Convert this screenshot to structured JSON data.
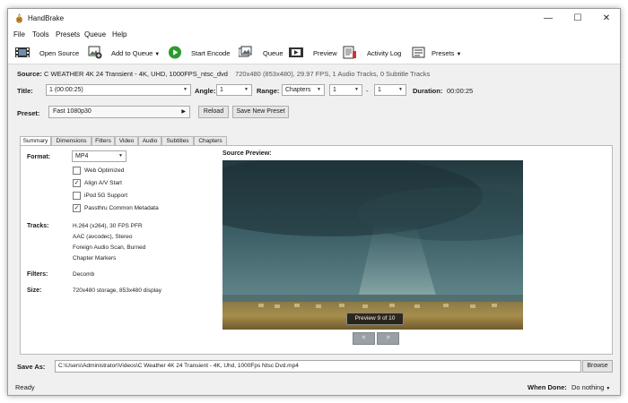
{
  "window": {
    "title": "HandBrake"
  },
  "menu": [
    "File",
    "Tools",
    "Presets",
    "Queue",
    "Help"
  ],
  "toolbar": {
    "open_source": "Open Source",
    "add_to_queue": "Add to Queue",
    "start_encode": "Start Encode",
    "queue": "Queue",
    "preview": "Preview",
    "activity_log": "Activity Log",
    "presets": "Presets"
  },
  "source": {
    "label": "Source:",
    "name": "C  WEATHER  4K 24  Transient - 4K, UHD, 1000FPS_ntsc_dvd",
    "details": "720x480 (853x480), 29.97 FPS, 1 Audio Tracks, 0 Subtitle Tracks"
  },
  "title_row": {
    "title_label": "Title:",
    "title_value": "1  (00:00:25)",
    "angle_label": "Angle:",
    "angle_value": "1",
    "range_label": "Range:",
    "range_type": "Chapters",
    "range_start": "1",
    "range_sep": "-",
    "range_end": "1",
    "duration_label": "Duration:",
    "duration_value": "00:00:25"
  },
  "preset_row": {
    "label": "Preset:",
    "value": "Fast 1080p30",
    "reload": "Reload",
    "save_new": "Save New Preset"
  },
  "tabs": [
    "Summary",
    "Dimensions",
    "Filters",
    "Video",
    "Audio",
    "Subtitles",
    "Chapters"
  ],
  "summary": {
    "format_label": "Format:",
    "format_value": "MP4",
    "options": [
      {
        "label": "Web Optimized",
        "checked": false
      },
      {
        "label": "Align A/V Start",
        "checked": true
      },
      {
        "label": "iPod 5G Support",
        "checked": false
      },
      {
        "label": "Passthru Common Metadata",
        "checked": true
      }
    ],
    "tracks_label": "Tracks:",
    "tracks": [
      "H.264 (x264), 30 FPS PFR",
      "AAC (avcodec), Stereo",
      "Foreign Audio Scan, Burned",
      "Chapter Markers"
    ],
    "filters_label": "Filters:",
    "filters_value": "Decomb",
    "size_label": "Size:",
    "size_value": "720x480 storage, 853x480 display",
    "preview_title": "Source Preview:",
    "preview_badge": "Preview 9 of 10",
    "prev_btn": "<",
    "next_btn": ">"
  },
  "save_as": {
    "label": "Save As:",
    "path": "C:\\Users\\Administrator\\Videos\\C  Weather  4K 24  Transient - 4K, Uhd, 1000Fps Ntsc Dvd.mp4",
    "browse": "Browse"
  },
  "status": {
    "text": "Ready",
    "when_done_label": "When Done:",
    "when_done_value": "Do nothing"
  },
  "colors": {
    "play_green": "#2e9a2e",
    "accent_blue": "#1f5fa8"
  }
}
